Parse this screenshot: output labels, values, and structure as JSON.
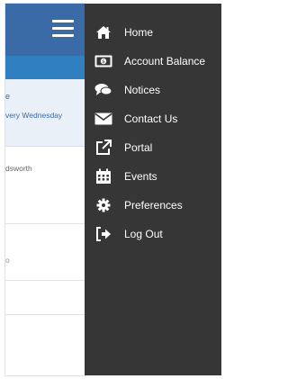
{
  "background_app": {
    "notice_title_partial": "e",
    "notice_subtitle_partial": "very Wednesday",
    "row_text_partial": "dsworth",
    "row_text_2_partial": "o"
  },
  "drawer": {
    "items": [
      {
        "label": "Home",
        "icon": "home-icon"
      },
      {
        "label": "Account Balance",
        "icon": "account-balance-icon"
      },
      {
        "label": "Notices",
        "icon": "notices-icon"
      },
      {
        "label": "Contact Us",
        "icon": "envelope-icon"
      },
      {
        "label": "Portal",
        "icon": "external-link-icon"
      },
      {
        "label": "Events",
        "icon": "calendar-icon"
      },
      {
        "label": "Preferences",
        "icon": "gear-icon"
      },
      {
        "label": "Log Out",
        "icon": "logout-icon"
      }
    ]
  },
  "colors": {
    "drawer_bg": "#363636",
    "topbar_bg": "#3b6ba6",
    "subbar_bg": "#2f7fc1",
    "notice_bg": "#e9f0f8"
  }
}
